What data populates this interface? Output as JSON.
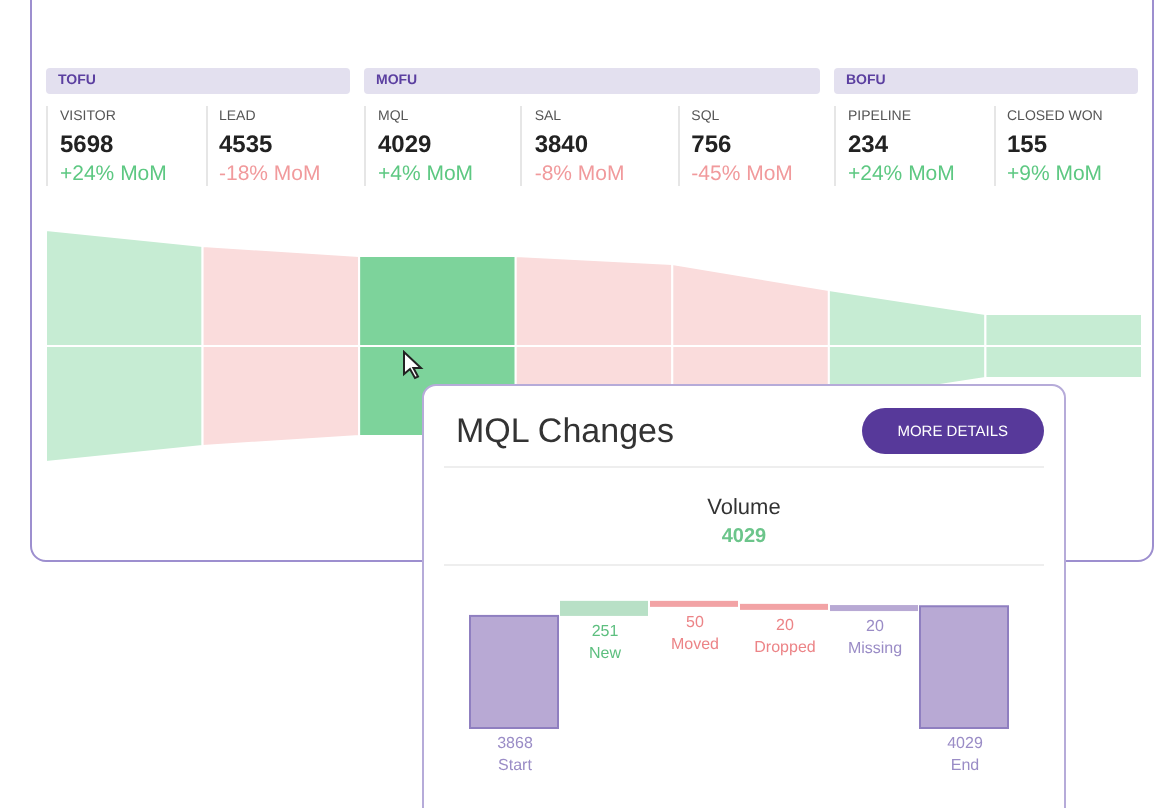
{
  "groups": [
    {
      "label": "TOFU",
      "metrics": [
        {
          "label": "VISITOR",
          "value": "5698",
          "change": "+24% MoM",
          "color": "#5dc882",
          "selected": false
        },
        {
          "label": "LEAD",
          "value": "4535",
          "change": "-18% MoM",
          "color": "#f19a9c",
          "selected": false
        }
      ]
    },
    {
      "label": "MOFU",
      "metrics": [
        {
          "label": "MQL",
          "value": "4029",
          "change": "+4% MoM",
          "color": "#5dc882",
          "selected": true
        },
        {
          "label": "SAL",
          "value": "3840",
          "change": "-8% MoM",
          "color": "#f19a9c",
          "selected": false
        },
        {
          "label": "SQL",
          "value": "756",
          "change": "-45% MoM",
          "color": "#f19a9c",
          "selected": false
        }
      ]
    },
    {
      "label": "BOFU",
      "metrics": [
        {
          "label": "PIPELINE",
          "value": "234",
          "change": "+24% MoM",
          "color": "#5dc882",
          "selected": false
        },
        {
          "label": "CLOSED WON",
          "value": "155",
          "change": "+9% MoM",
          "color": "#5dc882",
          "selected": false
        }
      ]
    }
  ],
  "popup": {
    "title": "MQL Changes",
    "button": "MORE DETAILS",
    "volume_label": "Volume",
    "volume_value": "4029",
    "waterfall": [
      {
        "kind": "total",
        "value": "3868",
        "label": "Start"
      },
      {
        "kind": "increase",
        "value": "251",
        "label": "New"
      },
      {
        "kind": "decrease",
        "value": "50",
        "label": "Moved"
      },
      {
        "kind": "decrease",
        "value": "20",
        "label": "Dropped"
      },
      {
        "kind": "missing",
        "value": "20",
        "label": "Missing"
      },
      {
        "kind": "total",
        "value": "4029",
        "label": "End"
      }
    ]
  }
}
